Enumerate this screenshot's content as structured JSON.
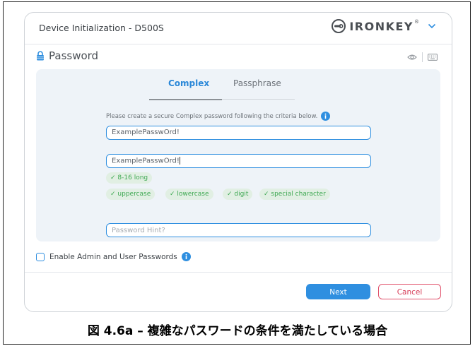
{
  "window": {
    "title": "Device Initialization - D500S",
    "brand": "IRONKEY",
    "brand_reg": "®",
    "brand_icon": "ironkey-logo-icon",
    "menu_icon": "chevron-down-icon"
  },
  "header": {
    "title": "Password",
    "icon": "lock-icon",
    "right_icons": [
      "eye-icon",
      "keyboard-icon"
    ]
  },
  "tabs": [
    {
      "label": "Complex",
      "active": true
    },
    {
      "label": "Passphrase",
      "active": false
    }
  ],
  "form": {
    "instruction": "Please create a secure Complex password following the criteria below.",
    "password_value": "ExamplePasswOrd!",
    "confirm_value": "ExamplePasswOrd!",
    "hint_placeholder": "Password Hint?",
    "criteria": [
      "✓ 8-16 long",
      "✓ uppercase",
      "✓ lowercase",
      "✓ digit",
      "✓ special character"
    ]
  },
  "admin": {
    "label": "Enable Admin and User Passwords",
    "checked": false
  },
  "buttons": {
    "next": "Next",
    "cancel": "Cancel"
  },
  "caption": "図 4.6a – 複雑なパスワードの条件を満たしている場合",
  "colors": {
    "accent": "#2f8fe0",
    "success": "#3ea852",
    "danger": "#e0506a",
    "panel": "#eef3f8"
  }
}
